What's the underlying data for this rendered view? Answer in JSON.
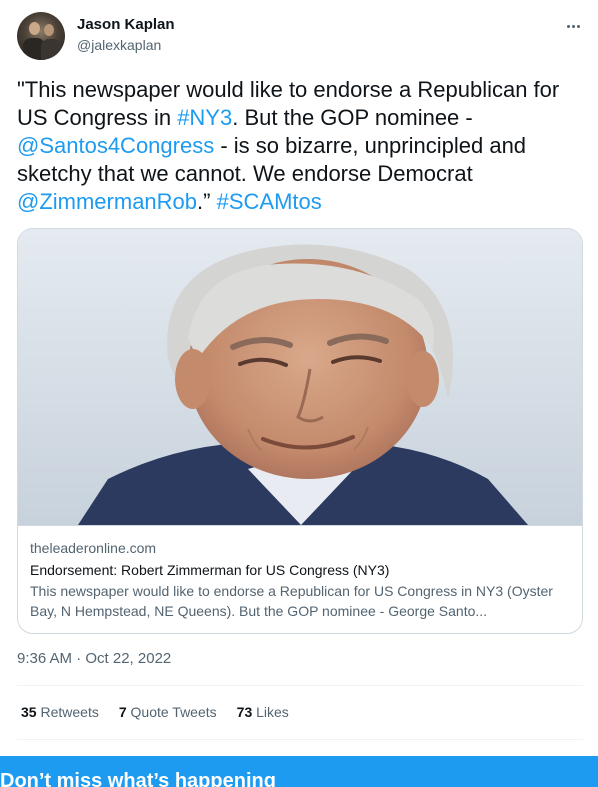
{
  "author": {
    "name": "Jason Kaplan",
    "handle": "@jalexkaplan",
    "avatar_icon": "profile-photo"
  },
  "more_icon": "more-horizontal-icon",
  "tweet": {
    "t1": "\"This newspaper would like to endorse a Republican for US Congress in ",
    "hashtag1": "#NY3",
    "t2": ". But the GOP nominee - ",
    "mention1": "@Santos4Congress",
    "t3": "  - is so bizarre, unprincipled and sketchy that we cannot.  We endorse Democrat ",
    "mention2": "@ZimmermanRob",
    "t4": ".” ",
    "hashtag2": "#SCAMtos"
  },
  "card": {
    "domain": "theleaderonline.com",
    "title": "Endorsement: Robert Zimmerman for US Congress (NY3)",
    "description": "This newspaper would like to endorse a Republican for US Congress in NY3 (Oyster Bay, N Hempstead, NE Queens). But the GOP nominee - George Santo..."
  },
  "timestamp": "9:36 AM · Oct 22, 2022",
  "stats": {
    "retweets_count": "35",
    "retweets_label": "Retweets",
    "quotes_count": "7",
    "quotes_label": "Quote Tweets",
    "likes_count": "73",
    "likes_label": "Likes"
  },
  "banner": {
    "text": "Don’t miss what’s happening"
  },
  "colors": {
    "link": "#1d9bf0",
    "banner": "#1d9bf0",
    "secondary_text": "#536471"
  }
}
